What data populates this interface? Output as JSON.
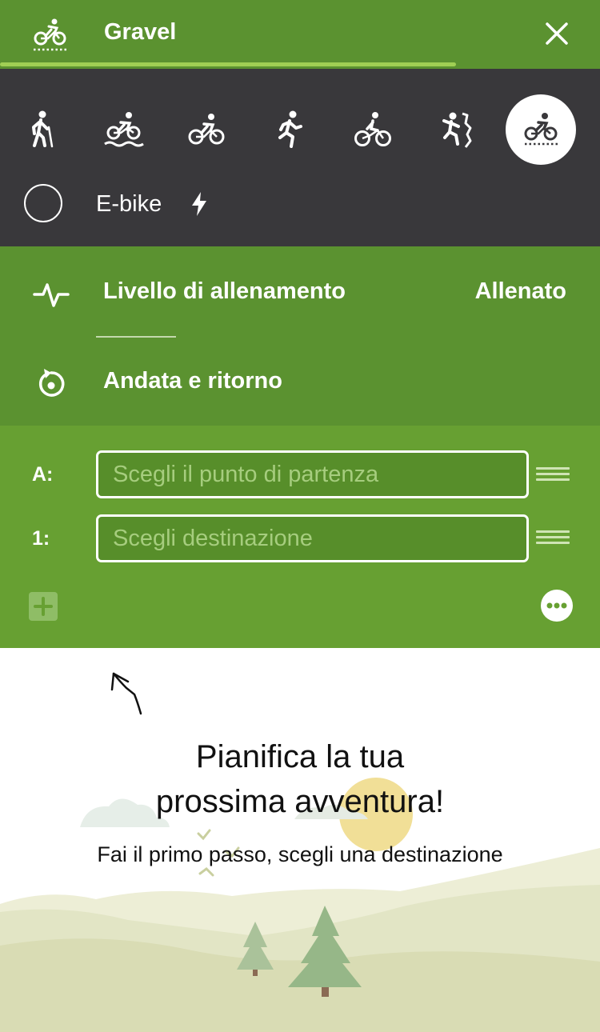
{
  "header": {
    "title": "Gravel",
    "icon": "gravel-bike-icon",
    "close_icon": "close-icon",
    "accent_color": "#5b9230"
  },
  "sports": [
    {
      "name": "hiking",
      "icon": "hiking-icon",
      "selected": false
    },
    {
      "name": "bike-touring",
      "icon": "bike-touring-icon",
      "selected": false
    },
    {
      "name": "road-cycling",
      "icon": "road-bike-icon",
      "selected": false
    },
    {
      "name": "running",
      "icon": "running-icon",
      "selected": false
    },
    {
      "name": "mountain-biking",
      "icon": "mtb-icon",
      "selected": false
    },
    {
      "name": "mountaineering",
      "icon": "mountaineering-icon",
      "selected": false
    },
    {
      "name": "gravel",
      "icon": "gravel-bike-icon",
      "selected": true
    }
  ],
  "ebike": {
    "label": "E-bike",
    "checked": false,
    "icon": "lightning-icon"
  },
  "options": {
    "fitness": {
      "label": "Livello di allenamento",
      "value": "Allenato",
      "icon": "pulse-icon"
    },
    "round_trip": {
      "label": "Andata e ritorno",
      "icon": "round-trip-icon"
    }
  },
  "waypoints": [
    {
      "label": "A:",
      "placeholder": "Scegli il punto di partenza",
      "value": ""
    },
    {
      "label": "1:",
      "placeholder": "Scegli destinazione",
      "value": ""
    }
  ],
  "actions": {
    "add_icon": "plus-icon",
    "more_icon": "more-icon"
  },
  "empty_state": {
    "title_line1": "Pianifica la tua",
    "title_line2": "prossima avventura!",
    "subtitle": "Fai il primo passo, scegli una destinazione"
  }
}
